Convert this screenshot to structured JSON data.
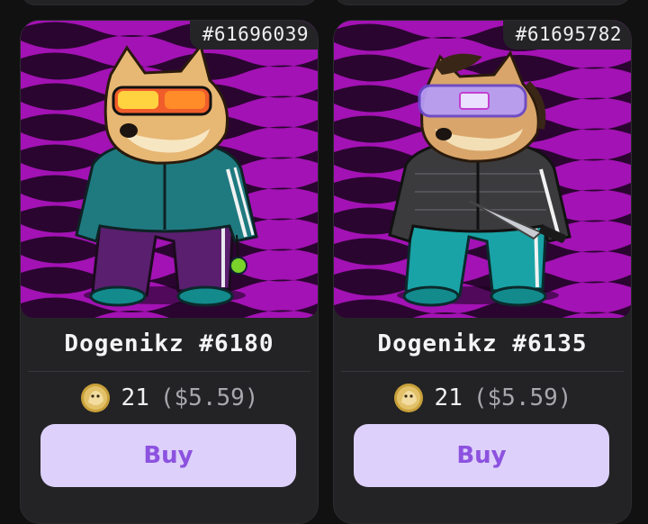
{
  "cards": [
    {
      "token_id": "#61696039",
      "title": "Dogenikz #6180",
      "price": "21",
      "price_usd": "($5.59)",
      "buy_label": "Buy",
      "currency_icon": "dogecoin-icon",
      "art": {
        "description_icon": "doge-avatar-image",
        "accessory": "rainbow-visor-sunglasses",
        "jacket_color": "#1f7a80",
        "pants_color": "#5a1f6e",
        "background_colors": [
          "#c51ad6",
          "#3a0440"
        ]
      }
    },
    {
      "token_id": "#61695782",
      "title": "Dogenikz #6135",
      "price": "21",
      "price_usd": "($5.59)",
      "buy_label": "Buy",
      "currency_icon": "dogecoin-icon",
      "art": {
        "description_icon": "doge-avatar-image",
        "accessory": "neon-visor-and-knife",
        "jacket_color": "#3b3b3e",
        "pants_color": "#1aa3a6",
        "background_colors": [
          "#c51ad6",
          "#3a0440"
        ]
      }
    }
  ],
  "colors": {
    "page_bg": "#111112",
    "card_bg": "#232325",
    "button_bg": "#ddd0fb",
    "button_text": "#8c52df",
    "muted_text": "#a7a7ad"
  }
}
